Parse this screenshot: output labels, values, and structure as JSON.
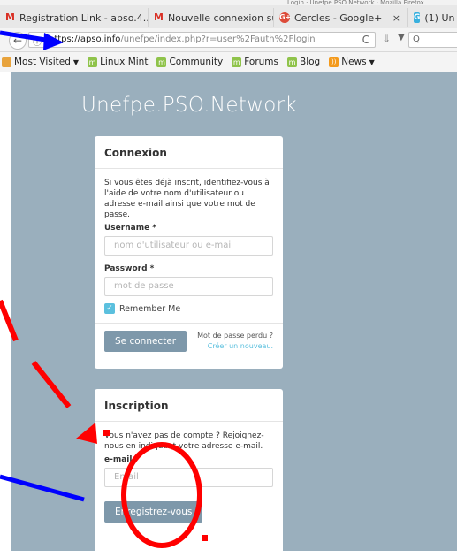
{
  "title_strip": "Login · Unefpe PSO Network · Mozilla Firefox",
  "tabs": [
    {
      "icon": "gmail-icon",
      "glyph": "M",
      "label": "Registration Link - apso.4...",
      "close": "×"
    },
    {
      "icon": "gmail-icon",
      "glyph": "M",
      "label": "Nouvelle connexion sur l'...",
      "close": "×"
    },
    {
      "icon": "google-plus-icon",
      "glyph": "G+",
      "label": "Cercles - Google+",
      "close": "×"
    },
    {
      "icon": "google-plus-icon",
      "glyph": "G",
      "label": "(1) Un",
      "close": ""
    }
  ],
  "address": {
    "domain": "https://apso.info",
    "path": "/unefpe/index.php?r=user%2Fauth%2Flogin",
    "reload_glyph": "C",
    "search_glyph": "Q"
  },
  "bookmarks": [
    {
      "label": "Most Visited",
      "icon": "none",
      "caret": "▼"
    },
    {
      "label": "Linux Mint",
      "icon": "mint-icon"
    },
    {
      "label": "Community",
      "icon": "mint-icon"
    },
    {
      "label": "Forums",
      "icon": "mint-icon"
    },
    {
      "label": "Blog",
      "icon": "mint-icon"
    },
    {
      "label": "News",
      "icon": "rss-icon",
      "caret": "▼"
    }
  ],
  "site_title": "Unefpe.PSO.Network",
  "login": {
    "heading": "Connexion",
    "intro": "Si vous êtes déjà inscrit, identifiez-vous à l'aide de votre nom d'utilisateur ou adresse e-mail ainsi que votre mot de passe.",
    "username_label": "Username *",
    "username_placeholder": "nom d'utilisateur ou e-mail",
    "password_label": "Password *",
    "password_placeholder": "mot de passe",
    "remember_label": "Remember Me",
    "remember_checked": true,
    "submit_label": "Se connecter",
    "forgot_text": "Mot de passe perdu ?",
    "forgot_link": "Créer un nouveau."
  },
  "register": {
    "heading": "Inscription",
    "intro": "Vous n'avez pas de compte ? Rejoignez-nous en indiquant votre adresse e-mail.",
    "email_label": "e-mail *",
    "email_placeholder": "Email",
    "submit_label": "Enregistrez-vous"
  },
  "colors": {
    "page_bg": "#9aafbd",
    "button": "#7e98aa",
    "accent": "#5bc0de",
    "annotation_red": "#ff0000",
    "annotation_blue": "#0000ff"
  }
}
